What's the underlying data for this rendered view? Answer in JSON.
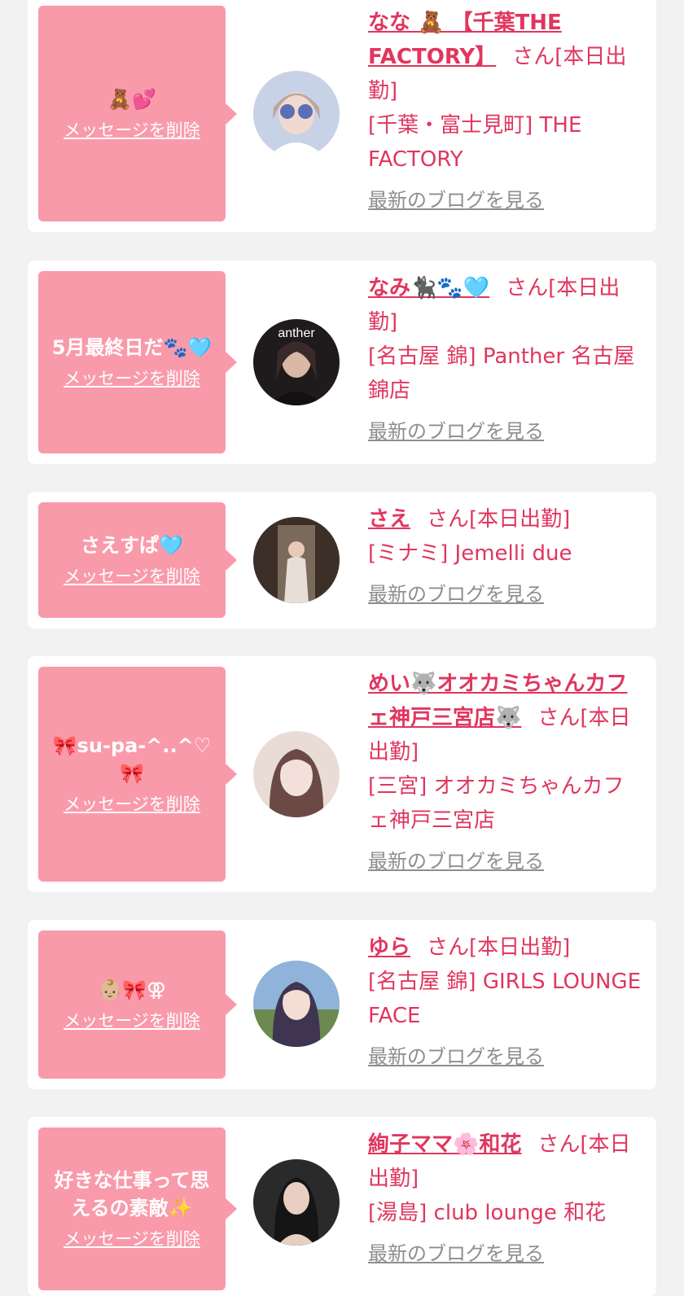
{
  "entries": [
    {
      "message": "🧸💕",
      "delete_label": "メッセージを削除",
      "name": "なな 🧸 【千葉THE FACTORY】",
      "suffix": "さん[本日出勤]",
      "shop": "[千葉・富士見町] THE FACTORY",
      "blog_label": "最新のブログを見る",
      "avatar_colors": [
        "#c7d2e6",
        "#5a6fb5"
      ]
    },
    {
      "message": "5月最終日だ🐾🩵",
      "delete_label": "メッセージを削除",
      "name": "なみ🐈‍⬛🐾🩵",
      "suffix": "さん[本日出勤]",
      "shop": "[名古屋 錦] Panther 名古屋錦店",
      "blog_label": "最新のブログを見る",
      "avatar_colors": [
        "#1f1a1c",
        "#d9b8a6"
      ]
    },
    {
      "message": "さえすぱ🩵",
      "delete_label": "メッセージを削除",
      "name": "さえ",
      "suffix": "さん[本日出勤]",
      "shop": "[ミナミ] Jemelli due",
      "blog_label": "最新のブログを見る",
      "avatar_colors": [
        "#3b2f28",
        "#e7dfd5"
      ]
    },
    {
      "message": "🎀su-pa-^..^♡🎀",
      "delete_label": "メッセージを削除",
      "name": "めい🐺オオカミちゃんカフェ神戸三宮店🐺",
      "suffix": "さん[本日出勤]",
      "shop": "[三宮] オオカミちゃんカフェ神戸三宮店",
      "blog_label": "最新のブログを見る",
      "avatar_colors": [
        "#e9dcd6",
        "#6b4a45"
      ]
    },
    {
      "message": "👶🏼🎀⚢",
      "delete_label": "メッセージを削除",
      "name": "ゆら",
      "suffix": "さん[本日出勤]",
      "shop": "[名古屋 錦] GIRLS LOUNGE FACE",
      "blog_label": "最新のブログを見る",
      "avatar_colors": [
        "#8fb3d9",
        "#3f3550"
      ]
    },
    {
      "message": "好きな仕事って思えるの素敵✨",
      "delete_label": "メッセージを削除",
      "name": "絢子ママ🌸和花",
      "suffix": "さん[本日出勤]",
      "shop": "[湯島] club lounge 和花",
      "blog_label": "最新のブログを見る",
      "avatar_colors": [
        "#2a2a2a",
        "#e8cfc2"
      ]
    }
  ]
}
